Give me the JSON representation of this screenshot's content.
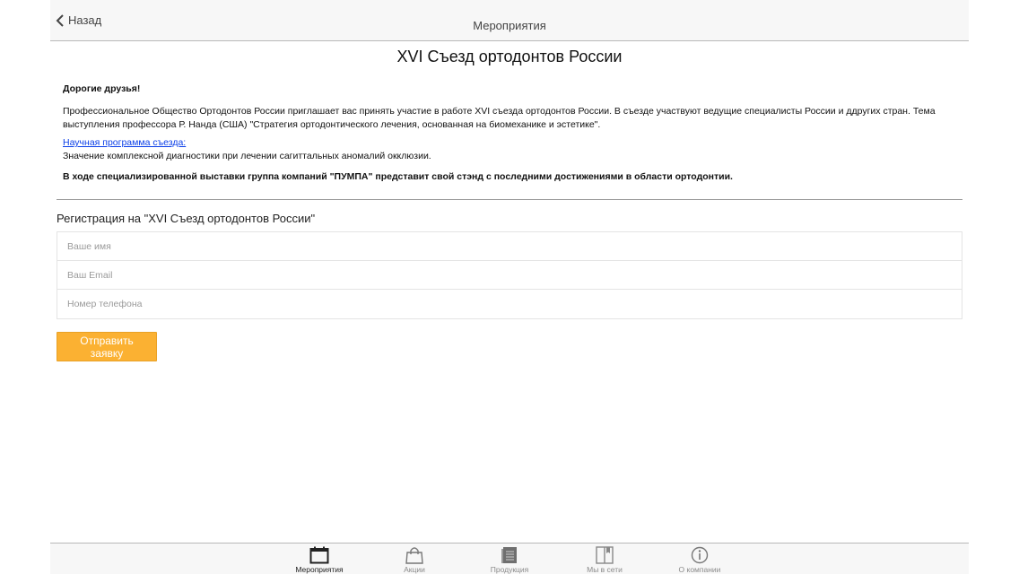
{
  "header": {
    "back_label": "Назад",
    "title": "Мероприятия"
  },
  "event": {
    "title": "XVI Съезд ортодонтов России",
    "greeting": "Дорогие друзья!",
    "intro": "Профессиональное Общество Ортодонтов России приглашает вас принять участие в работе XVI съезда ортодонтов России. В съезде участвуют ведущие специалисты России и ддругих стран. Тема выступления профессора Р. Нанда (США) \"Стратегия ортодонтического лечения, основанная на биомеханике и эстетике\".",
    "program_link": "Научная программа съезда:",
    "program_text": "Значение комплексной диагностики при лечении сагиттальных аномалий окклюзии.",
    "exhibition_note": "В ходе специализированной выставки группа компаний \"ПУМПА\" представит свой стэнд с последними достижениями в области ортодонтии."
  },
  "registration": {
    "title": "Регистрация на \"XVI Съезд ортодонтов России\"",
    "name_placeholder": "Ваше имя",
    "name_value": "",
    "email_placeholder": "Ваш Email",
    "email_value": "",
    "phone_placeholder": "Номер телефона",
    "phone_value": "",
    "submit_label": "Отправить заявку"
  },
  "tabs": [
    {
      "label": "Мероприятия",
      "icon": "calendar-icon",
      "active": true
    },
    {
      "label": "Акции",
      "icon": "shopping-bag-icon",
      "active": false
    },
    {
      "label": "Продукция",
      "icon": "catalog-icon",
      "active": false
    },
    {
      "label": "Мы в сети",
      "icon": "book-icon",
      "active": false
    },
    {
      "label": "О компании",
      "icon": "info-icon",
      "active": false
    }
  ],
  "colors": {
    "accent": "#fbb132",
    "link": "#0a3ee8",
    "bar_background": "#f7f7f7"
  }
}
